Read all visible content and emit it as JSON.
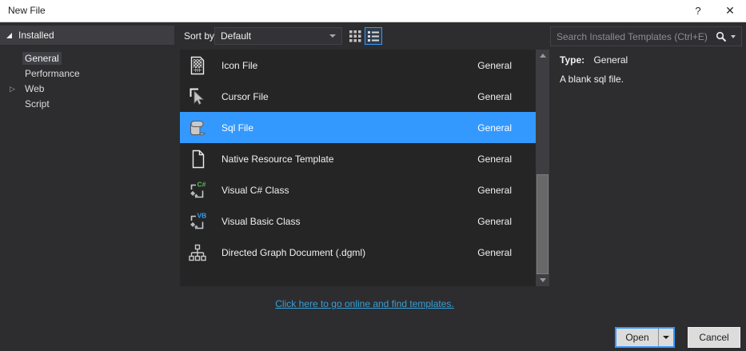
{
  "window": {
    "title": "New File",
    "help_glyph": "?",
    "close_glyph": "✕"
  },
  "sidebar": {
    "header_label": "Installed",
    "items": [
      {
        "label": "General",
        "selected": true
      },
      {
        "label": "Performance",
        "selected": false
      },
      {
        "label": "Web",
        "selected": false,
        "expandable": true,
        "expander_glyph": "▷"
      },
      {
        "label": "Script",
        "selected": false
      }
    ]
  },
  "toolbar": {
    "sort_label": "Sort by:",
    "sort_value": "Default",
    "search_placeholder": "Search Installed Templates (Ctrl+E)"
  },
  "templates": {
    "items": [
      {
        "name": "Icon File",
        "category": "General",
        "selected": false
      },
      {
        "name": "Cursor File",
        "category": "General",
        "selected": false
      },
      {
        "name": "Sql File",
        "category": "General",
        "selected": true
      },
      {
        "name": "Native Resource Template",
        "category": "General",
        "selected": false
      },
      {
        "name": "Visual C# Class",
        "category": "General",
        "selected": false,
        "badge": "C#",
        "badge_color": "#5bb75b"
      },
      {
        "name": "Visual Basic Class",
        "category": "General",
        "selected": false,
        "badge": "VB",
        "badge_color": "#35a0ee"
      },
      {
        "name": "Directed Graph Document (.dgml)",
        "category": "General",
        "selected": false
      }
    ]
  },
  "details": {
    "type_label": "Type:",
    "type_value": "General",
    "description": "A blank sql file."
  },
  "footer": {
    "online_link": "Click here to go online and find templates.",
    "open_label": "Open",
    "cancel_label": "Cancel"
  },
  "colors": {
    "selection_blue": "#3399ff",
    "link_blue": "#389fd6",
    "titlebar_bg": "#ffffff",
    "dialog_bg": "#2d2d30",
    "list_bg": "#252526",
    "button_bg": "#dcdcdc"
  }
}
